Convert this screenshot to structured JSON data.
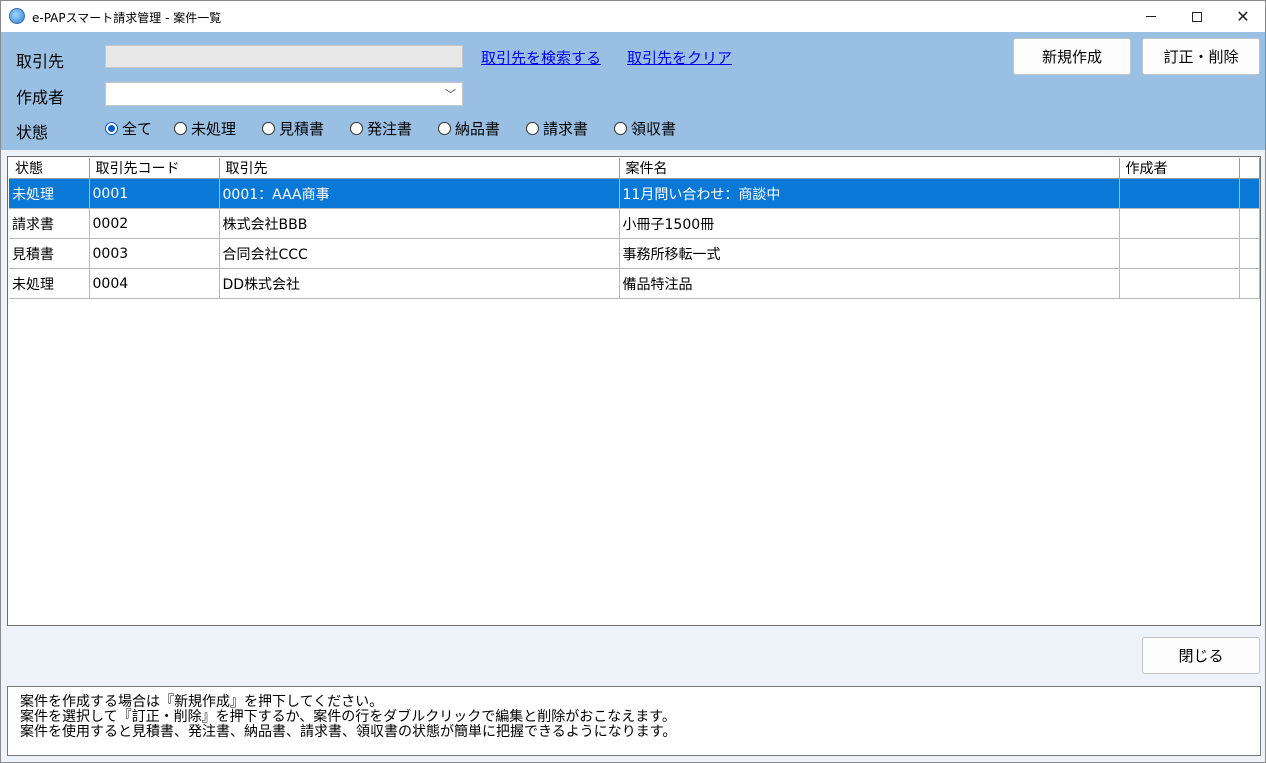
{
  "window": {
    "title": "e-PAPスマート請求管理 - 案件一覧"
  },
  "filters": {
    "client_label": "取引先",
    "client_value": "",
    "search_client_link": "取引先を検索する",
    "clear_client_link": "取引先をクリア",
    "author_label": "作成者",
    "author_selected": "",
    "status_label": "状態",
    "status_options": [
      {
        "label": "全て",
        "checked": true
      },
      {
        "label": "未処理",
        "checked": false
      },
      {
        "label": "見積書",
        "checked": false
      },
      {
        "label": "発注書",
        "checked": false
      },
      {
        "label": "納品書",
        "checked": false
      },
      {
        "label": "請求書",
        "checked": false
      },
      {
        "label": "領収書",
        "checked": false
      }
    ]
  },
  "toolbar": {
    "new_label": "新規作成",
    "edit_delete_label": "訂正・削除",
    "close_label": "閉じる"
  },
  "table": {
    "columns": [
      "状態",
      "取引先コード",
      "取引先",
      "案件名",
      "作成者",
      ""
    ],
    "rows": [
      {
        "status": "未処理",
        "code": "0001",
        "client": "0001：AAA商事",
        "project": "11月問い合わせ：商談中",
        "author": "",
        "selected": true
      },
      {
        "status": "請求書",
        "code": "0002",
        "client": "株式会社BBB",
        "project": "小冊子1500冊",
        "author": "",
        "selected": false
      },
      {
        "status": "見積書",
        "code": "0003",
        "client": "合同会社CCC",
        "project": "事務所移転一式",
        "author": "",
        "selected": false
      },
      {
        "status": "未処理",
        "code": "0004",
        "client": "DD株式会社",
        "project": "備品特注品",
        "author": "",
        "selected": false
      }
    ]
  },
  "help": {
    "lines": [
      "案件を作成する場合は『新規作成』を押下してください。",
      "案件を選択して『訂正・削除』を押下するか、案件の行をダブルクリックで編集と削除がおこなえます。",
      "案件を使用すると見積書、発注書、納品書、請求書、領収書の状態が簡単に把握できるようになります。"
    ]
  },
  "colors": {
    "panel": "#99bfe3",
    "selected_row": "#0a78d7",
    "link": "#0000ee"
  }
}
